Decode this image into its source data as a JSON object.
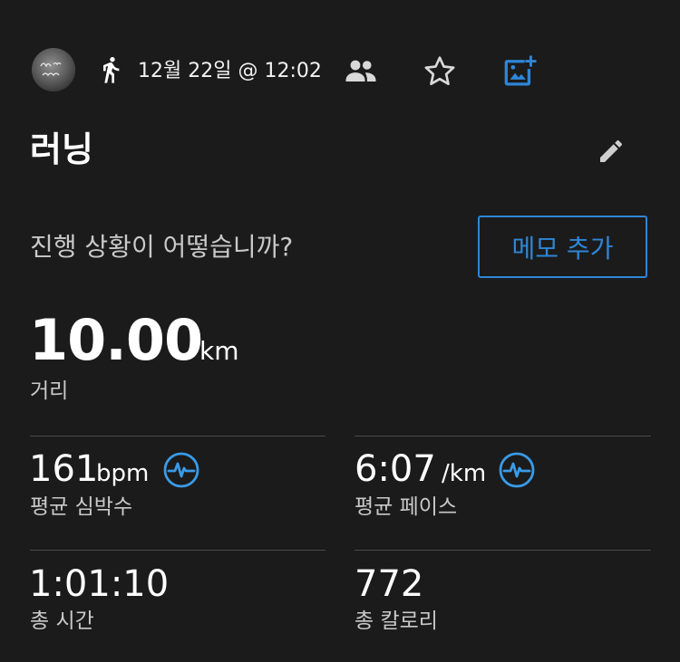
{
  "header": {
    "date_time": "12월 22일 @ 12:02",
    "icons": {
      "activity": "running-icon",
      "people": "people-icon",
      "favorite": "star-outline-icon",
      "add_photo": "add-photo-icon"
    },
    "accent_color": "#2f86d6"
  },
  "activity": {
    "title": "러닝",
    "prompt": "진행 상황이 어떻습니까?",
    "memo_button_label": "메모 추가"
  },
  "distance": {
    "value": "10.00",
    "unit": "km",
    "label": "거리"
  },
  "stats": {
    "heart_rate": {
      "value": "161",
      "unit": "bpm",
      "label": "평균 심박수"
    },
    "pace": {
      "value": "6:07",
      "unit": "/km",
      "label": "평균 페이스"
    },
    "total_time": {
      "value": "1:01:10",
      "label": "총 시간"
    },
    "calories": {
      "value": "772",
      "label": "총 칼로리"
    }
  }
}
